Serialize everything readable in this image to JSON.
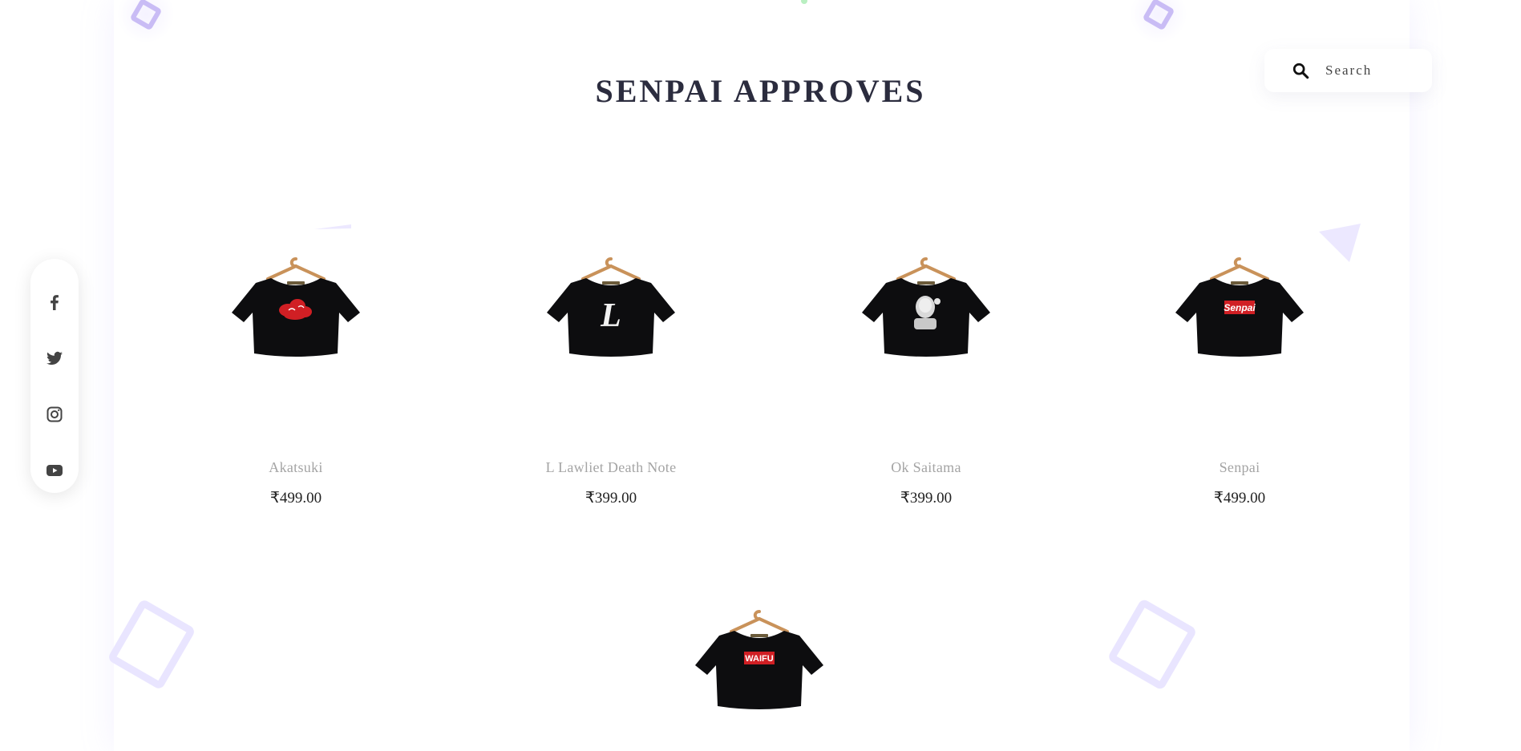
{
  "section": {
    "title": "SENPAI APPROVES"
  },
  "search": {
    "placeholder": "Search",
    "value": ""
  },
  "social": [
    {
      "name": "facebook-icon"
    },
    {
      "name": "twitter-icon"
    },
    {
      "name": "instagram-icon"
    },
    {
      "name": "youtube-icon"
    }
  ],
  "products": [
    {
      "name": "Akatsuki",
      "price": "₹499.00",
      "print": "akatsuki-cloud"
    },
    {
      "name": "L Lawliet Death Note",
      "price": "₹399.00",
      "print": "letter-l"
    },
    {
      "name": "Ok Saitama",
      "price": "₹399.00",
      "print": "saitama"
    },
    {
      "name": "Senpai",
      "price": "₹499.00",
      "print": "senpai-label"
    },
    {
      "name": "",
      "price": "",
      "print": "waifu-label"
    }
  ],
  "print_labels": {
    "senpai": "Senpai",
    "waifu": "WAIFU",
    "letter": "L"
  },
  "colors": {
    "title": "#2b2c3e",
    "name": "#a4a4a4",
    "price": "#222222",
    "accent_lavender": "#e9e5ff",
    "label_red": "#d01f24"
  }
}
